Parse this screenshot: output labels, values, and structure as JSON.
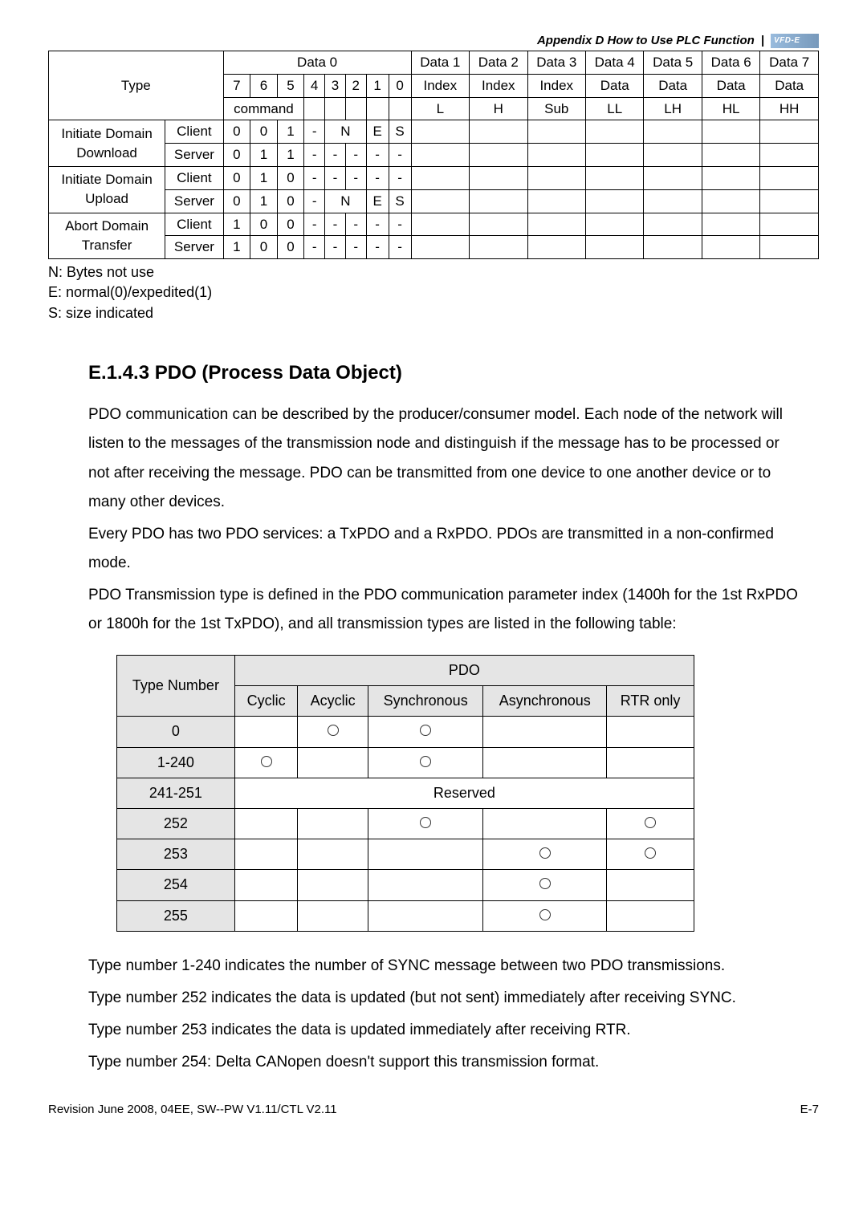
{
  "appendix_title": "Appendix D How to Use PLC Function",
  "table1": {
    "type_label": "Type",
    "data0_label": "Data 0",
    "headers_num": [
      "7",
      "6",
      "5",
      "4",
      "3",
      "2",
      "1",
      "0"
    ],
    "command_label": "command",
    "data_cols": [
      {
        "top": "Data 1",
        "mid": "Index",
        "bot": "L"
      },
      {
        "top": "Data 2",
        "mid": "Index",
        "bot": "H"
      },
      {
        "top": "Data 3",
        "mid": "Index",
        "bot": "Sub"
      },
      {
        "top": "Data 4",
        "mid": "Data",
        "bot": "LL"
      },
      {
        "top": "Data 5",
        "mid": "Data",
        "bot": "LH"
      },
      {
        "top": "Data 6",
        "mid": "Data",
        "bot": "HL"
      },
      {
        "top": "Data 7",
        "mid": "Data",
        "bot": "HH"
      }
    ],
    "rows": [
      {
        "name": "Initiate Domain Download",
        "sub": [
          {
            "role": "Client",
            "b": [
              "0",
              "0",
              "1",
              "-",
              "N",
              "",
              "E",
              "S"
            ]
          },
          {
            "role": "Server",
            "b": [
              "0",
              "1",
              "1",
              "-",
              "-",
              "-",
              "-",
              "-"
            ]
          }
        ]
      },
      {
        "name": "Initiate Domain Upload",
        "sub": [
          {
            "role": "Client",
            "b": [
              "0",
              "1",
              "0",
              "-",
              "-",
              "-",
              "-",
              "-"
            ]
          },
          {
            "role": "Server",
            "b": [
              "0",
              "1",
              "0",
              "-",
              "N",
              "",
              "E",
              "S"
            ]
          }
        ]
      },
      {
        "name": "Abort Domain Transfer",
        "sub": [
          {
            "role": "Client",
            "b": [
              "1",
              "0",
              "0",
              "-",
              "-",
              "-",
              "-",
              "-"
            ]
          },
          {
            "role": "Server",
            "b": [
              "1",
              "0",
              "0",
              "-",
              "-",
              "-",
              "-",
              "-"
            ]
          }
        ]
      }
    ]
  },
  "notes": {
    "n1": "N: Bytes not use",
    "n2": "E: normal(0)/expedited(1)",
    "n3": "S: size indicated"
  },
  "section_heading": "E.1.4.3 PDO (Process Data Object)",
  "para1": "PDO communication can be described by the producer/consumer model. Each node of the network will listen to the messages of the transmission node and distinguish if the message has to be processed or not after receiving the message. PDO can be transmitted from one device to one another device or to many other devices.",
  "para2": "Every PDO has two PDO services: a TxPDO and a RxPDO. PDOs are transmitted in a non-confirmed mode.",
  "para3": "PDO Transmission type is defined in the PDO communication parameter index (1400h for the 1st RxPDO or 1800h for the 1st TxPDO), and all transmission types are listed in the following table:",
  "table2": {
    "type_number": "Type Number",
    "pdo": "PDO",
    "cols": [
      "Cyclic",
      "Acyclic",
      "Synchronous",
      "Asynchronous",
      "RTR only"
    ],
    "reserved": "Reserved",
    "rows": [
      {
        "tn": "0",
        "cells": [
          "",
          "o",
          "o",
          "",
          ""
        ]
      },
      {
        "tn": "1-240",
        "cells": [
          "o",
          "",
          "o",
          "",
          ""
        ]
      },
      {
        "tn": "241-251",
        "reserved": true
      },
      {
        "tn": "252",
        "cells": [
          "",
          "",
          "o",
          "",
          "o"
        ]
      },
      {
        "tn": "253",
        "cells": [
          "",
          "",
          "",
          "o",
          "o"
        ]
      },
      {
        "tn": "254",
        "cells": [
          "",
          "",
          "",
          "o",
          ""
        ]
      },
      {
        "tn": "255",
        "cells": [
          "",
          "",
          "",
          "o",
          ""
        ]
      }
    ]
  },
  "para4": "Type number 1-240 indicates the number of SYNC message between two PDO transmissions.",
  "para5": "Type number 252 indicates the data is updated (but not sent) immediately after receiving SYNC.",
  "para6": "Type number 253 indicates the data is updated immediately after receiving RTR.",
  "para7": "Type number 254: Delta CANopen doesn't support this transmission format.",
  "footer_left": "Revision June 2008, 04EE, SW--PW V1.11/CTL V2.11",
  "footer_right": "E-7"
}
